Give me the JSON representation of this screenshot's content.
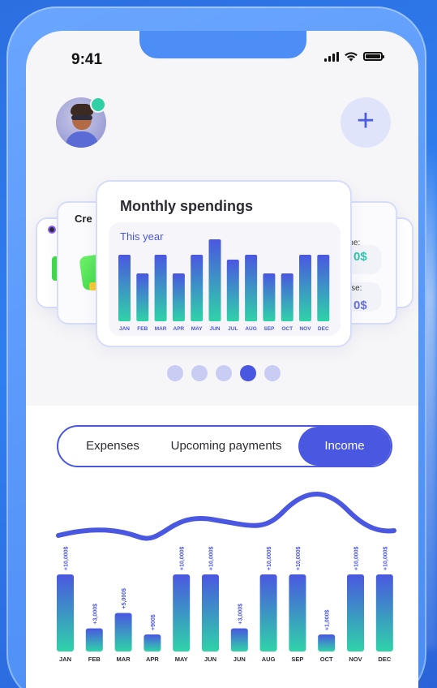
{
  "status": {
    "time": "9:41"
  },
  "header": {
    "add_label": "+"
  },
  "cards": {
    "left_title": "Cre",
    "right": {
      "label_income": "ome:",
      "value_income": "0$",
      "label_expense": "ense:",
      "value_expense": "0$"
    },
    "main": {
      "title": "Monthly spendings",
      "subtitle": "This year"
    }
  },
  "carousel": {
    "count": 5,
    "active_index": 3
  },
  "tabs": [
    {
      "label": "Expenses",
      "active": false
    },
    {
      "label": "Upcoming payments",
      "active": false
    },
    {
      "label": "Income",
      "active": true
    }
  ],
  "colors": {
    "accent": "#4a57e0",
    "bar_top": "#4a57e0",
    "bar_bottom": "#2fd3a8",
    "online": "#2fd0a6"
  },
  "chart_data": [
    {
      "type": "bar",
      "title": "Monthly spendings",
      "subtitle": "This year",
      "categories": [
        "JAN",
        "FEB",
        "MAR",
        "APR",
        "MAY",
        "JUN",
        "JUL",
        "AUG",
        "SEP",
        "OCT",
        "NOV",
        "DEC"
      ],
      "values": [
        82,
        59,
        82,
        59,
        82,
        101,
        76,
        82,
        59,
        59,
        82,
        82
      ]
    },
    {
      "type": "bar",
      "categories": [
        "JAN",
        "FEB",
        "MAR",
        "APR",
        "MAY",
        "JUN",
        "JUN",
        "AUG",
        "SEP",
        "OCT",
        "NOV",
        "DEC"
      ],
      "values": [
        10000,
        3000,
        5000,
        900,
        10000,
        10000,
        3000,
        10000,
        10000,
        1000,
        10000,
        10000
      ],
      "labels": [
        "+10,000$",
        "+3,000$",
        "+5,000$",
        "+900$",
        "+10,000$",
        "+10,000$",
        "+3,000$",
        "+10,000$",
        "+10,000$",
        "+1,000$",
        "+10,000$",
        "+10,000$"
      ]
    }
  ]
}
